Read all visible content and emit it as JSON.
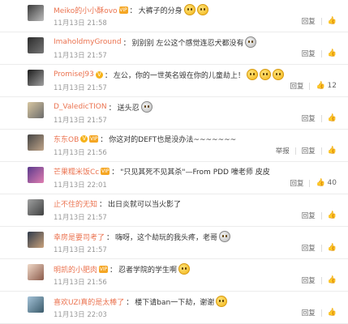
{
  "actions": {
    "reply": "回复",
    "report": "举报"
  },
  "comments": [
    {
      "user": "Meiko的小小酥ovo",
      "badge": "vip",
      "text": "大裤子的分身",
      "emojis": [
        "smile",
        "smile"
      ],
      "time": "11月13日 21:58",
      "report": false,
      "likes": ""
    },
    {
      "user": "ImaholdmyGround",
      "badge": "",
      "text": "别别别  左公这个感觉连忍犬都没有",
      "emojis": [
        "dog"
      ],
      "time": "11月13日 21:57",
      "report": false,
      "likes": ""
    },
    {
      "user": "PromiseJ93",
      "badge": "v",
      "text": "左公，你的一世英名毁在你的儿童劫上！",
      "emojis": [
        "smile",
        "smile",
        "smile"
      ],
      "time": "11月13日 21:57",
      "report": false,
      "likes": "12"
    },
    {
      "user": "D_ValedicTION",
      "badge": "",
      "text": "送头忍",
      "emojis": [
        "dog"
      ],
      "time": "11月13日 21:57",
      "report": false,
      "likes": ""
    },
    {
      "user": "东东OB",
      "badge": "v",
      "text": "你这对的DEFT也是没办法~~~~~~~",
      "emojis": [],
      "time": "11月13日 21:56",
      "report": true,
      "likes": ""
    },
    {
      "user": "芒果糯米饭Cc",
      "badge": "vip",
      "text": "\"只见其死不见其杀\"—From PDD 嚎老师 皮皮",
      "emojis": [],
      "time": "11月13日 22:01",
      "report": false,
      "likes": "40"
    },
    {
      "user": "止不住的无知",
      "badge": "",
      "text": "出日炎就可以当火影了",
      "emojis": [],
      "time": "11月13日 21:57",
      "report": false,
      "likes": ""
    },
    {
      "user": "幸房是要司考了",
      "badge": "",
      "text": "嗨呀，这个劫玩的我头疼，老哥",
      "emojis": [
        "dog"
      ],
      "time": "11月13日 21:57",
      "report": false,
      "likes": ""
    },
    {
      "user": "明凯的小肥肉",
      "badge": "vip",
      "text": "忍者学院的学生啊",
      "emojis": [
        "smile"
      ],
      "time": "11月13日 21:56",
      "report": false,
      "likes": ""
    },
    {
      "user": "喜欢UZI真的是太棒了",
      "badge": "",
      "text": "楼下请ban一下劫，谢谢",
      "emojis": [
        "smile"
      ],
      "time": "11月13日 22:03",
      "report": false,
      "likes": ""
    }
  ]
}
